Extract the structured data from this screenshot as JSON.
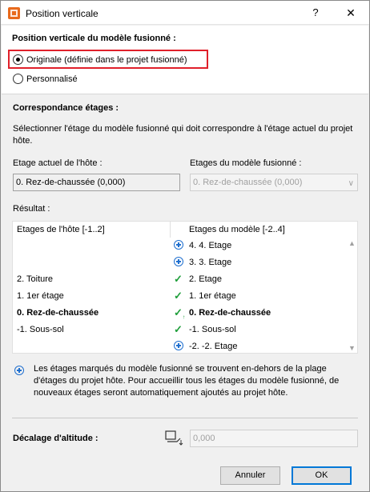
{
  "window": {
    "title": "Position verticale",
    "help": "?",
    "close": "✕"
  },
  "vertical_position": {
    "heading": "Position verticale du modèle fusionné :",
    "options": [
      {
        "label": "Originale (définie dans le projet fusionné)",
        "selected": true
      },
      {
        "label": "Personnalisé",
        "selected": false
      }
    ]
  },
  "story_matching": {
    "heading": "Correspondance étages :",
    "description": "Sélectionner l'étage du modèle fusionné qui doit correspondre à l'étage actuel du projet hôte.",
    "host_label": "Etage actuel de l'hôte :",
    "host_value": "0. Rez-de-chaussée (0,000)",
    "model_label": "Etages du modèle fusionné :",
    "model_value": "0. Rez-de-chaussée (0,000)"
  },
  "result": {
    "label": "Résultat :",
    "col_host": "Etages de l'hôte [-1..2]",
    "col_model": "Etages du modèle [-2..4]",
    "rows": [
      {
        "host": "",
        "icon": "plus-icon",
        "model": "4. 4. Etage",
        "bold": false
      },
      {
        "host": "",
        "icon": "plus-icon",
        "model": "3. 3. Etage",
        "bold": false
      },
      {
        "host": "2. Toiture",
        "icon": "check-icon",
        "model": "2. Etage",
        "bold": false
      },
      {
        "host": "1. 1er étage",
        "icon": "check-icon",
        "model": "1. 1er étage",
        "bold": false
      },
      {
        "host": "0. Rez-de-chaussée",
        "icon": "check-anchor-icon",
        "model": "0. Rez-de-chaussée",
        "bold": true
      },
      {
        "host": "-1. Sous-sol",
        "icon": "check-icon",
        "model": "-1. Sous-sol",
        "bold": false
      },
      {
        "host": "",
        "icon": "plus-icon",
        "model": "-2. -2. Etage",
        "bold": false
      }
    ]
  },
  "note": "Les étages marqués du modèle fusionné se trouvent en-dehors de la plage d'étages du projet hôte. Pour accueillir tous les étages du modèle fusionné, de nouveaux étages seront automatiquement ajoutés au projet hôte.",
  "elevation_offset": {
    "label": "Décalage d'altitude :",
    "value": "0,000"
  },
  "buttons": {
    "cancel": "Annuler",
    "ok": "OK"
  },
  "colors": {
    "accent": "#0078d7",
    "highlight": "#e0202a",
    "check": "#1e9e3a",
    "plus": "#1f6fcf"
  }
}
